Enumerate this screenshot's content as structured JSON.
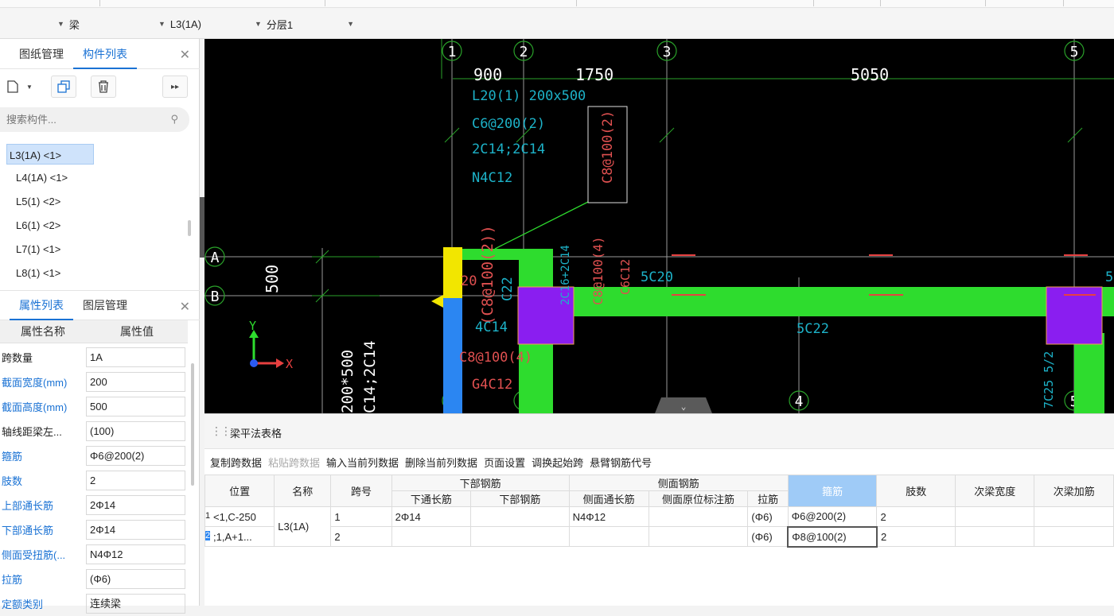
{
  "toolbar": {
    "combo_type": "梁",
    "combo_component": "L3(1A)",
    "combo_layer": "分层1"
  },
  "top_panel": {
    "tab_drawings": "图纸管理",
    "tab_components": "构件列表",
    "search_placeholder": "搜索构件...",
    "components": [
      "L3(1A) <1>",
      "L4(1A) <1>",
      "L5(1) <2>",
      "L6(1) <2>",
      "L7(1) <1>",
      "L8(1) <1>"
    ]
  },
  "props_panel": {
    "tab_props": "属性列表",
    "tab_layers": "图层管理",
    "head_name": "属性名称",
    "head_value": "属性值",
    "rows": [
      {
        "name": "跨数量",
        "value": "1A",
        "blue": false
      },
      {
        "name": "截面宽度(mm)",
        "value": "200",
        "blue": true
      },
      {
        "name": "截面高度(mm)",
        "value": "500",
        "blue": true
      },
      {
        "name": "轴线距梁左...",
        "value": "(100)",
        "blue": false
      },
      {
        "name": "箍筋",
        "value": "Φ6@200(2)",
        "blue": true
      },
      {
        "name": "肢数",
        "value": "2",
        "blue": true
      },
      {
        "name": "上部通长筋",
        "value": "2Φ14",
        "blue": true
      },
      {
        "name": "下部通长筋",
        "value": "2Φ14",
        "blue": true
      },
      {
        "name": "侧面受扭筋(...",
        "value": "N4Φ12",
        "blue": true
      },
      {
        "name": "拉筋",
        "value": "(Φ6)",
        "blue": true
      },
      {
        "name": "定额类别",
        "value": "连续梁",
        "blue": true
      }
    ]
  },
  "canvas": {
    "axes": [
      "1",
      "2",
      "3",
      "4",
      "5"
    ],
    "rows": [
      "A",
      "B"
    ],
    "dims": [
      "900",
      "1750",
      "5050"
    ],
    "dim_500": "500",
    "labels": {
      "l20": "L20(1) 200x500",
      "c6": "C6@200(2)",
      "c14": "2C14;2C14",
      "n4": "N4C12",
      "c8box": "C8@100(2)",
      "c8v": "(C8@100(2))",
      "c820": "20",
      "c22": "C22",
      "c2c14": "2C16+2C14",
      "c8_4v": "C8@100(4)",
      "c6c12": "C6C12",
      "c5c20": "5C20",
      "c5c22": "5C22",
      "c4c14": "4C14",
      "c8_4": "C8@100(4)",
      "g4": "G4C12",
      "c200": "200*500",
      "c14b": "C14;2C14",
      "c7c25": "7C25 5/2",
      "c5right": "5",
      "y": "Y",
      "x": "X"
    }
  },
  "bottom": {
    "title": "梁平法表格",
    "actions": [
      {
        "label": "复制跨数据",
        "disabled": false
      },
      {
        "label": "粘贴跨数据",
        "disabled": true
      },
      {
        "label": "输入当前列数据",
        "disabled": false
      },
      {
        "label": "删除当前列数据",
        "disabled": false
      },
      {
        "label": "页面设置",
        "disabled": false
      },
      {
        "label": "调换起始跨",
        "disabled": false
      },
      {
        "label": "悬臂钢筋代号",
        "disabled": false
      }
    ],
    "headers": {
      "pos": "位置",
      "name": "名称",
      "span": "跨号",
      "bottom_group": "下部钢筋",
      "bottom_long": "下通长筋",
      "bottom_bar": "下部钢筋",
      "side_group": "侧面钢筋",
      "side_long": "侧面通长筋",
      "side_orig": "侧面原位标注筋",
      "tie": "拉筋",
      "stirrup": "箍筋",
      "legs": "肢数",
      "sec_width": "次梁宽度",
      "sec_add": "次梁加筋"
    },
    "rows": [
      {
        "no": "1",
        "pos": "<1,C-250",
        "span": "1",
        "bottom_long": "2Φ14",
        "side_long": "N4Φ12",
        "tie": "(Φ6)",
        "stirrup": "Φ6@200(2)",
        "legs": "2"
      },
      {
        "no": "2",
        "pos": ";1,A+1...",
        "span": "2",
        "bottom_long": "",
        "side_long": "",
        "tie": "(Φ6)",
        "stirrup": "Φ8@100(2)",
        "legs": "2"
      }
    ],
    "merged_name": "L3(1A)"
  }
}
